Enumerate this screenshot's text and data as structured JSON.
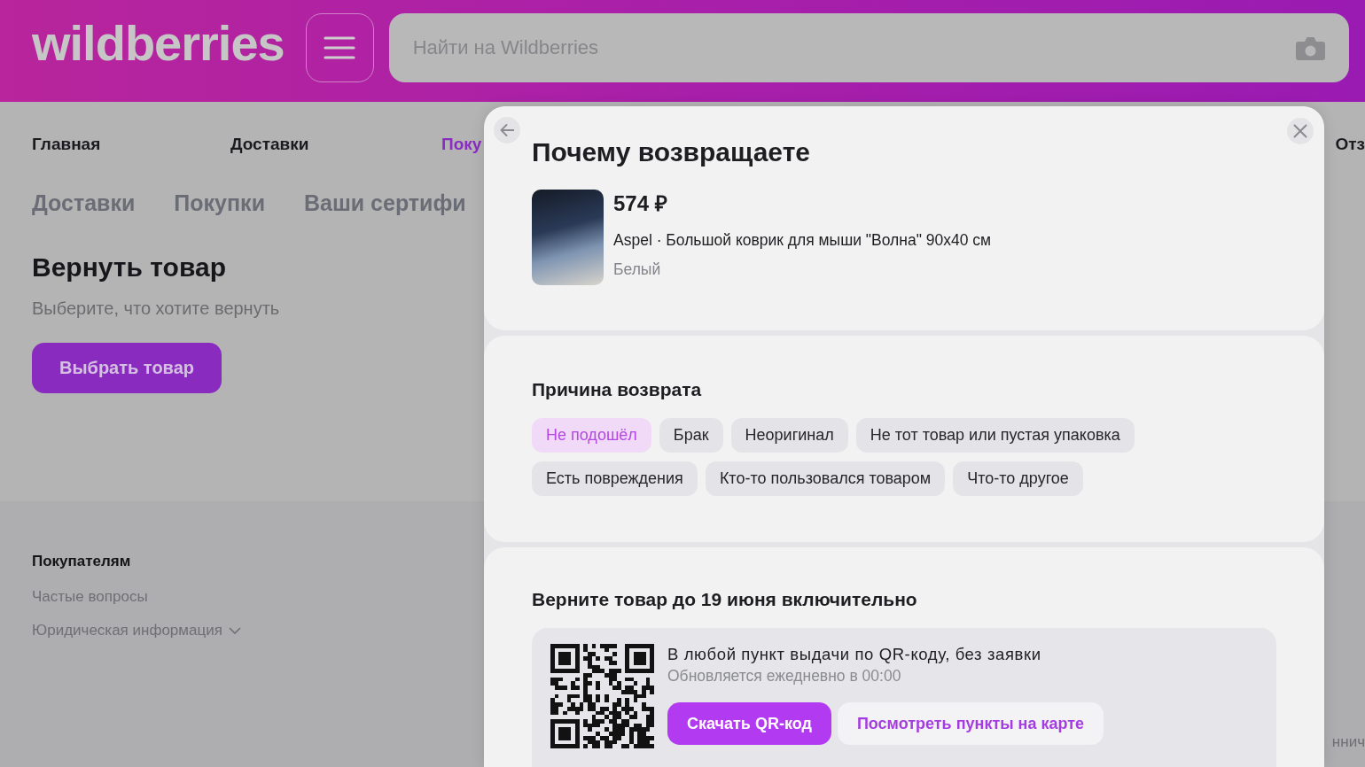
{
  "header": {
    "logo": "wildberries",
    "search": {
      "placeholder": "Найти на Wildberries"
    }
  },
  "nav": [
    {
      "label": "Главная",
      "selected": false
    },
    {
      "label": "Доставки",
      "selected": false
    },
    {
      "label": "Поку",
      "selected": true
    },
    {
      "label": "Отз",
      "selected": false
    }
  ],
  "tabs": [
    {
      "label": "Доставки",
      "selected": false
    },
    {
      "label": "Покупки",
      "selected": false
    },
    {
      "label": "Ваши сертифи",
      "selected": false
    }
  ],
  "return_page": {
    "title": "Вернуть товар",
    "subtitle": "Выберите, что хотите вернуть",
    "button": "Выбрать товар"
  },
  "footer": {
    "heading": "Покупателям",
    "links": [
      {
        "label": "Частые вопросы",
        "kind": "link"
      },
      {
        "label": "Юридическая информация",
        "kind": "dropdown"
      }
    ],
    "fragment": "ннич"
  },
  "modal": {
    "title": "Почему возвращаете",
    "product": {
      "price": "574 ₽",
      "name": "Aspel · Большой коврик для мыши \"Волна\" 90x40 см",
      "variant": "Белый"
    },
    "reason": {
      "title": "Причина возврата",
      "options": [
        {
          "label": "Не подошёл",
          "selected": true
        },
        {
          "label": "Брак",
          "selected": false
        },
        {
          "label": "Неоригинал",
          "selected": false
        },
        {
          "label": "Не тот товар или пустая упаковка",
          "selected": false
        },
        {
          "label": "Есть повреждения",
          "selected": false
        },
        {
          "label": "Кто-то пользовался товаром",
          "selected": false
        },
        {
          "label": "Что-то другое",
          "selected": false
        }
      ]
    },
    "return_info": {
      "title": "Верните товар до 19 июня включительно",
      "method": "В любой пункт выдачи по QR-коду, без заявки",
      "note": "Обновляется ежедневно в 00:00",
      "buttons": [
        {
          "label": "Скачать QR-код",
          "kind": "primary"
        },
        {
          "label": "Посмотреть пункты на карте",
          "kind": "secondary"
        }
      ]
    }
  }
}
